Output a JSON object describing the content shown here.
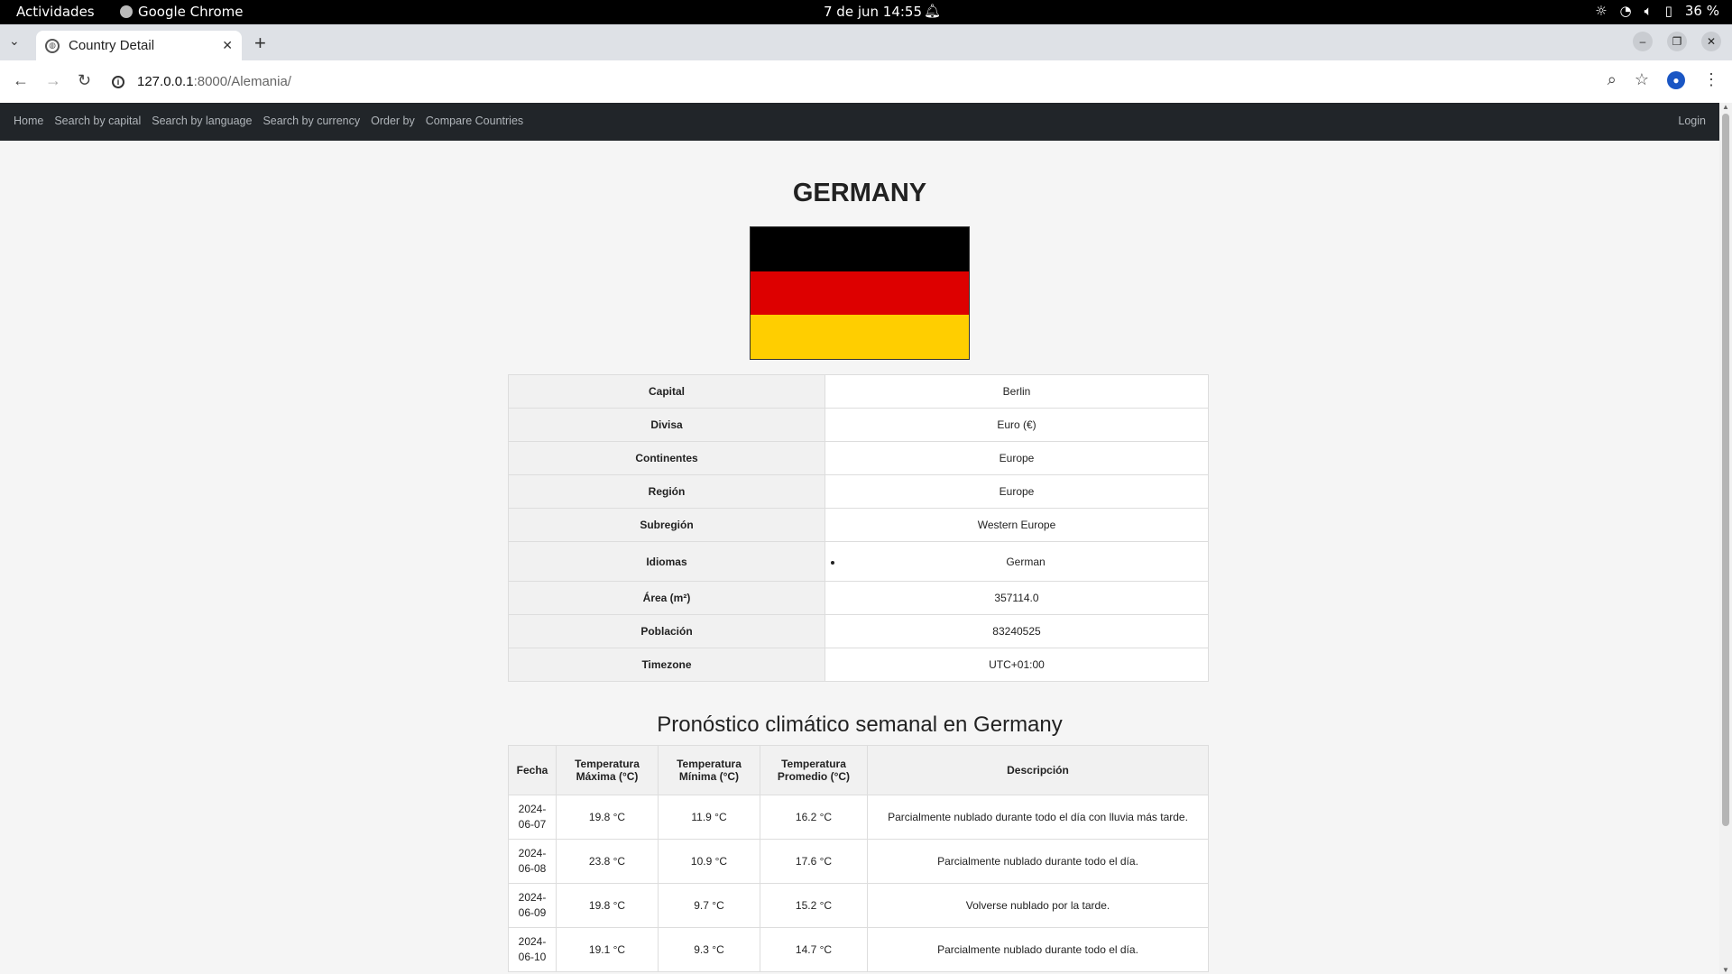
{
  "os": {
    "activities": "Actividades",
    "app": "Google Chrome",
    "clock": "7 de jun  14:55",
    "battery": "36 %"
  },
  "browser": {
    "tab_title": "Country Detail",
    "url_host": "127.0.0.1",
    "url_rest": ":8000/Alemania/"
  },
  "site_nav": {
    "links": [
      "Home",
      "Search by capital",
      "Search by language",
      "Search by currency",
      "Order by",
      "Compare Countries"
    ],
    "login": "Login"
  },
  "country": {
    "name": "GERMANY",
    "flag_colors": [
      "#000000",
      "#dd0000",
      "#ffce00"
    ],
    "rows": [
      {
        "label": "Capital",
        "value": "Berlin"
      },
      {
        "label": "Divisa",
        "value": "Euro (€)"
      },
      {
        "label": "Continentes",
        "value": "Europe"
      },
      {
        "label": "Región",
        "value": "Europe"
      },
      {
        "label": "Subregión",
        "value": "Western Europe"
      },
      {
        "label": "Idiomas",
        "list": [
          "German"
        ]
      },
      {
        "label": "Área (m²)",
        "value": "357114.0"
      },
      {
        "label": "Población",
        "value": "83240525"
      },
      {
        "label": "Timezone",
        "value": "UTC+01:00"
      }
    ]
  },
  "forecast": {
    "title": "Pronóstico climático semanal en Germany",
    "headers": [
      "Fecha",
      "Temperatura Máxima (°C)",
      "Temperatura Mínima (°C)",
      "Temperatura Promedio (°C)",
      "Descripción"
    ],
    "rows": [
      [
        "2024-06-07",
        "19.8 °C",
        "11.9 °C",
        "16.2 °C",
        "Parcialmente nublado durante todo el día con lluvia más tarde."
      ],
      [
        "2024-06-08",
        "23.8 °C",
        "10.9 °C",
        "17.6 °C",
        "Parcialmente nublado durante todo el día."
      ],
      [
        "2024-06-09",
        "19.8 °C",
        "9.7 °C",
        "15.2 °C",
        "Volverse nublado por la tarde."
      ],
      [
        "2024-06-10",
        "19.1 °C",
        "9.3 °C",
        "14.7 °C",
        "Parcialmente nublado durante todo el día."
      ]
    ]
  }
}
